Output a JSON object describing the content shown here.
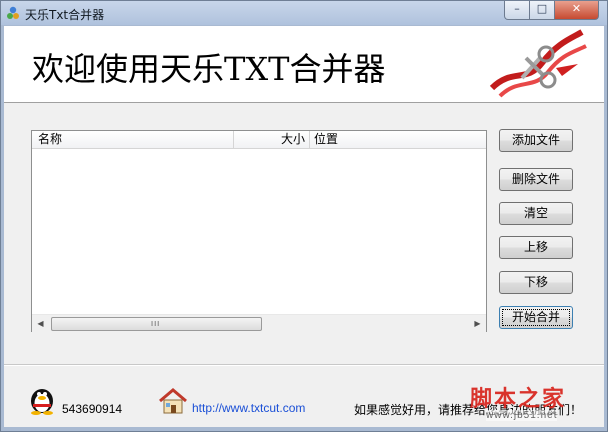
{
  "window": {
    "title": "天乐Txt合并器",
    "controls": {
      "minimize": "–",
      "maximize": "□",
      "close": "✕"
    }
  },
  "banner": {
    "title": "欢迎使用天乐TXT合并器"
  },
  "file_list": {
    "columns": [
      "名称",
      "大小",
      "位置"
    ],
    "rows": [],
    "scroll_grip": "III"
  },
  "buttons": {
    "add_file": "添加文件",
    "delete_file": "删除文件",
    "clear": "清空",
    "move_up": "上移",
    "move_down": "下移",
    "start_merge": "开始合并"
  },
  "footer": {
    "qq_number": "543690914",
    "website": "http://www.txtcut.com",
    "promo": "如果感觉好用，请推荐给您身边的朋友们！"
  },
  "watermark": {
    "main": "脚本之家",
    "sub": "www.jb51.net"
  },
  "colors": {
    "link": "#1a4fd6",
    "watermark": "#d8241c",
    "close_button": "#c64a31"
  }
}
